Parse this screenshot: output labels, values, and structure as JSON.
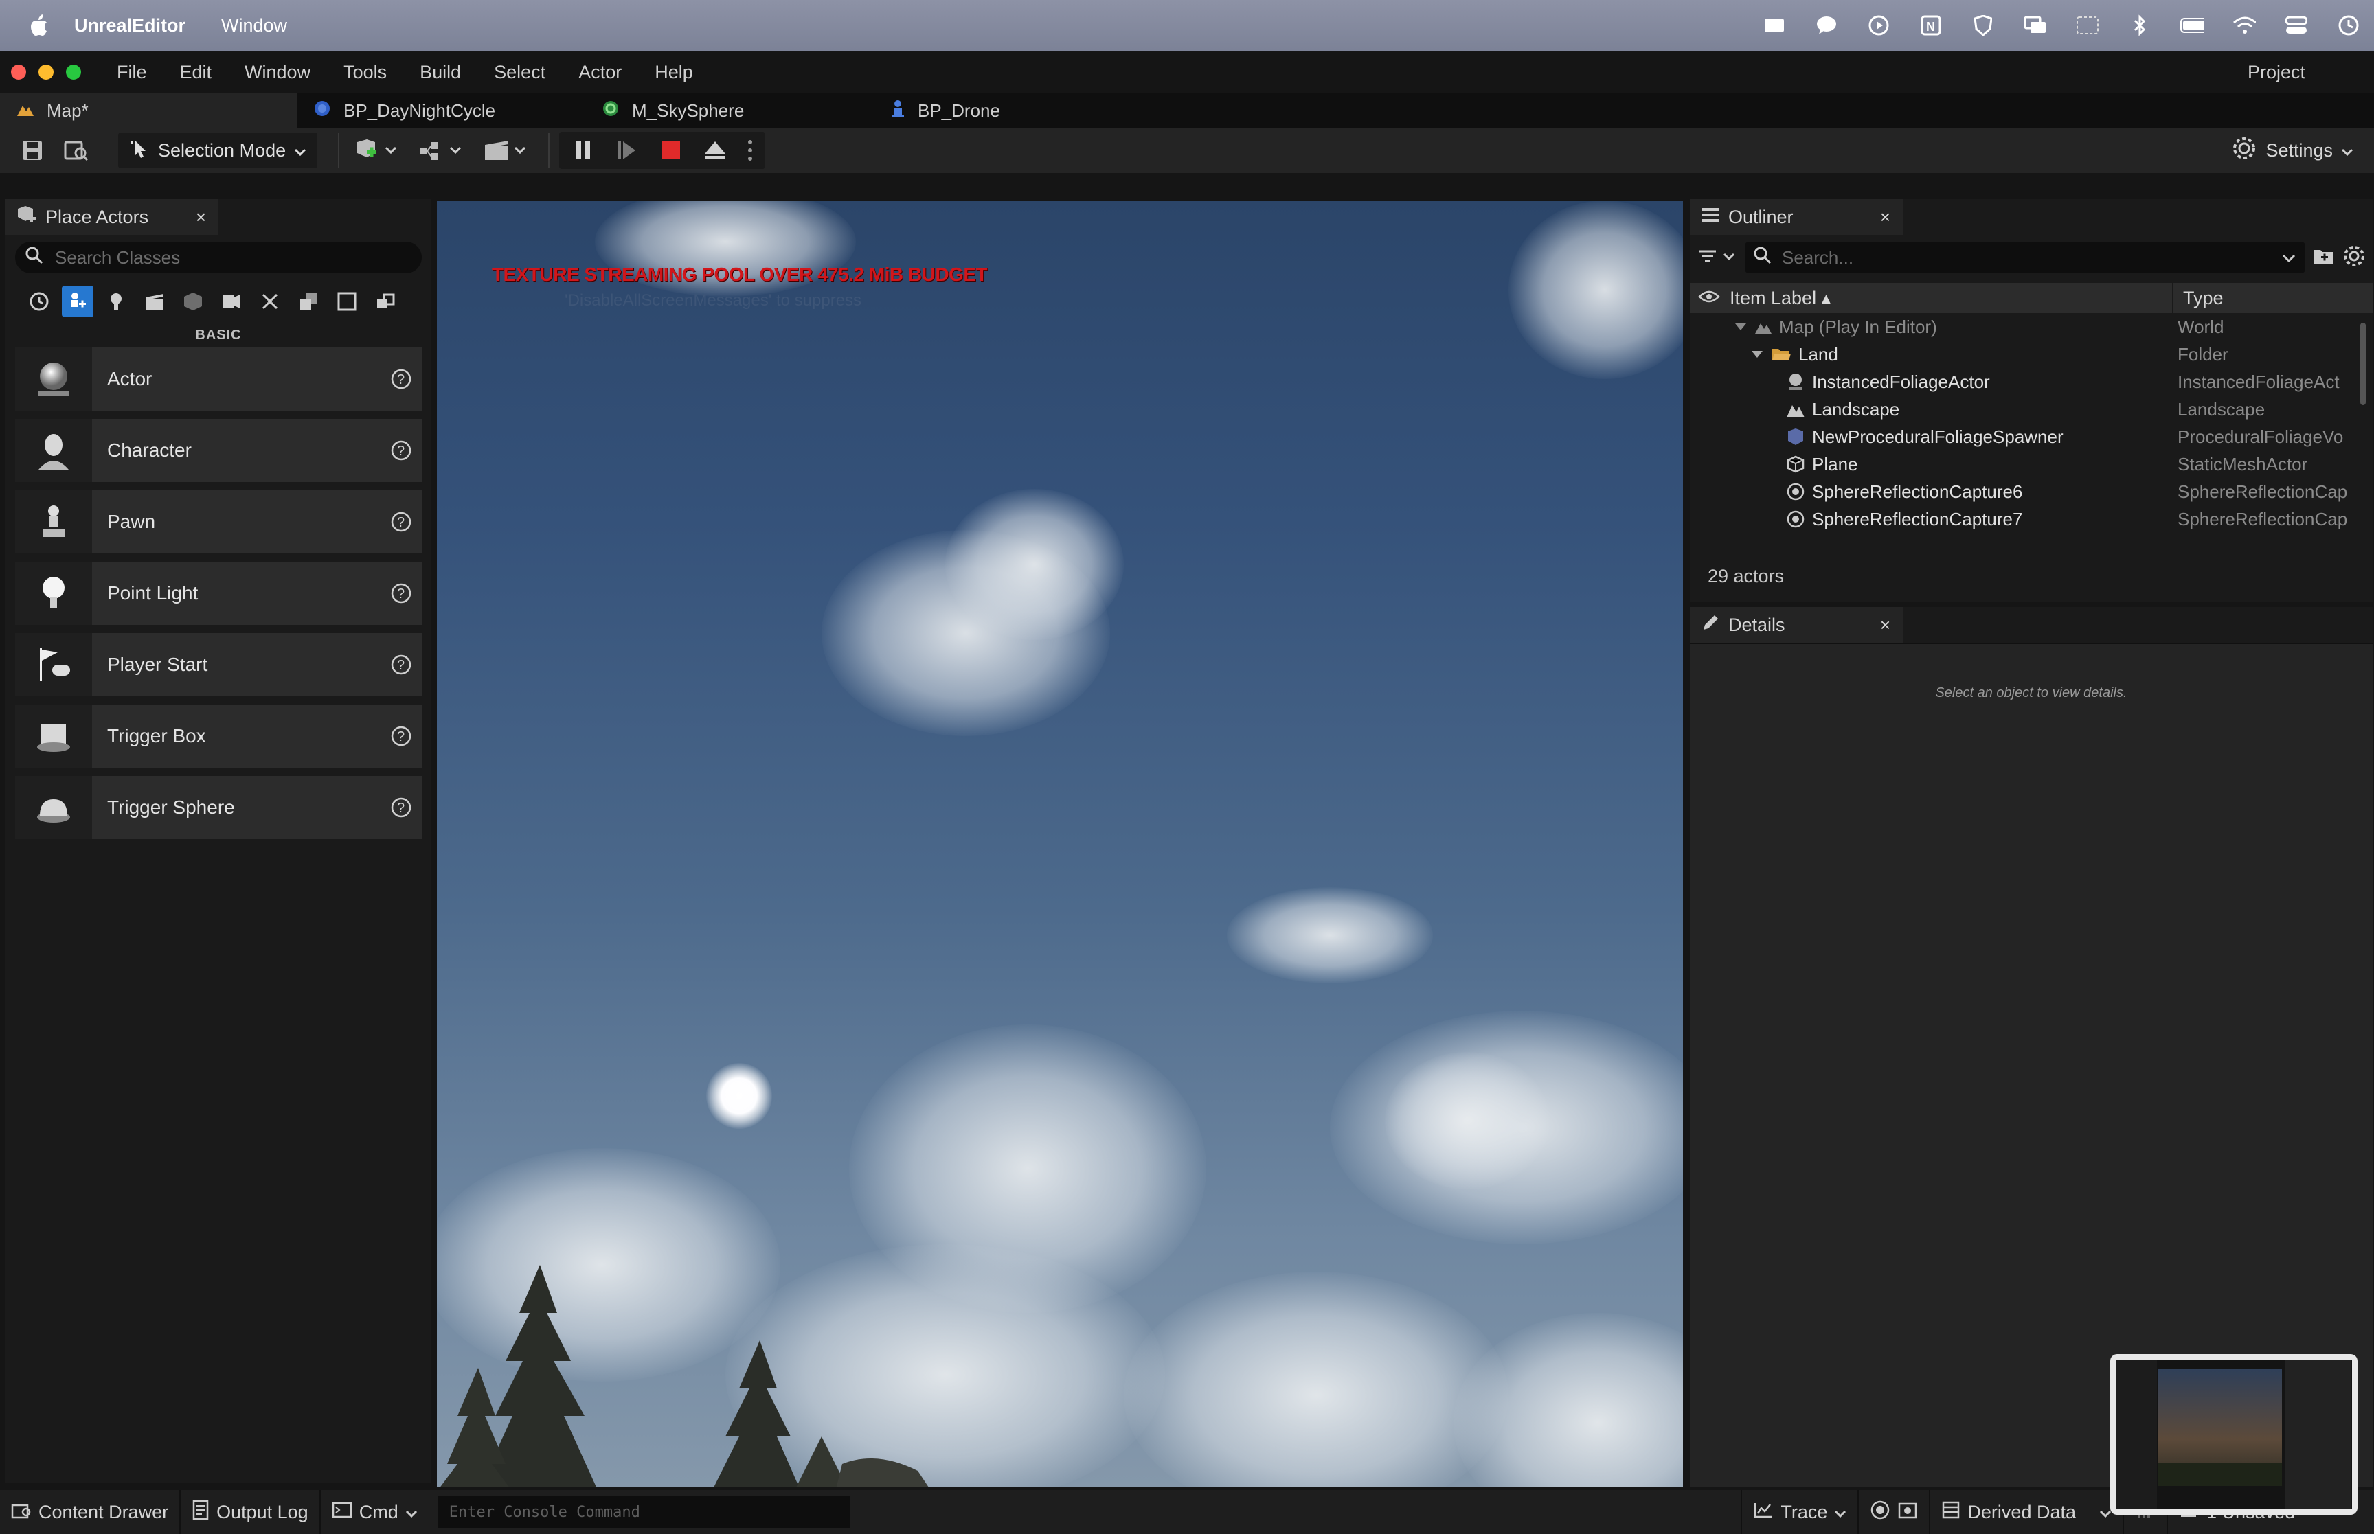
{
  "macbar": {
    "app_name": "UnrealEditor",
    "menu": [
      "Window"
    ]
  },
  "menubar": {
    "items": [
      "File",
      "Edit",
      "Window",
      "Tools",
      "Build",
      "Select",
      "Actor",
      "Help"
    ],
    "project": "Project"
  },
  "tabs": [
    {
      "label": "Map*",
      "icon": "map-icon",
      "active": true
    },
    {
      "label": "BP_DayNightCycle",
      "icon": "blueprint-icon"
    },
    {
      "label": "M_SkySphere",
      "icon": "material-icon"
    },
    {
      "label": "BP_Drone",
      "icon": "blueprint-actor-icon"
    }
  ],
  "toolbar": {
    "selection_mode": "Selection Mode",
    "settings": "Settings"
  },
  "place_actors": {
    "title": "Place Actors",
    "search_placeholder": "Search Classes",
    "category": "BASIC",
    "items": [
      {
        "label": "Actor"
      },
      {
        "label": "Character"
      },
      {
        "label": "Pawn"
      },
      {
        "label": "Point Light"
      },
      {
        "label": "Player Start"
      },
      {
        "label": "Trigger Box"
      },
      {
        "label": "Trigger Sphere"
      }
    ]
  },
  "viewport": {
    "warning": "TEXTURE STREAMING POOL OVER 475.2 MiB BUDGET",
    "warning_sub": "'DisableAllScreenMessages' to suppress"
  },
  "outliner": {
    "title": "Outliner",
    "search_placeholder": "Search...",
    "col_label": "Item Label",
    "col_type": "Type",
    "rows": [
      {
        "name": "Map (Play In Editor)",
        "type": "World",
        "dim": true
      },
      {
        "name": "Land",
        "type": "Folder"
      },
      {
        "name": "InstancedFoliageActor",
        "type": "InstancedFoliageAct"
      },
      {
        "name": "Landscape",
        "type": "Landscape"
      },
      {
        "name": "NewProceduralFoliageSpawner",
        "type": "ProceduralFoliageVo"
      },
      {
        "name": "Plane",
        "type": "StaticMeshActor"
      },
      {
        "name": "SphereReflectionCapture6",
        "type": "SphereReflectionCap"
      },
      {
        "name": "SphereReflectionCapture7",
        "type": "SphereReflectionCap"
      }
    ],
    "actor_count": "29 actors"
  },
  "details": {
    "title": "Details",
    "empty_msg": "Select an object to view details."
  },
  "statusbar": {
    "content_drawer": "Content Drawer",
    "output_log": "Output Log",
    "cmd": "Cmd",
    "console_placeholder": "Enter Console Command",
    "trace": "Trace",
    "derived_data": "Derived Data",
    "unsaved": "1 Unsaved"
  },
  "colors": {
    "accent": "#2678d0",
    "warning": "#d1161b",
    "stop": "#e02a2a"
  }
}
